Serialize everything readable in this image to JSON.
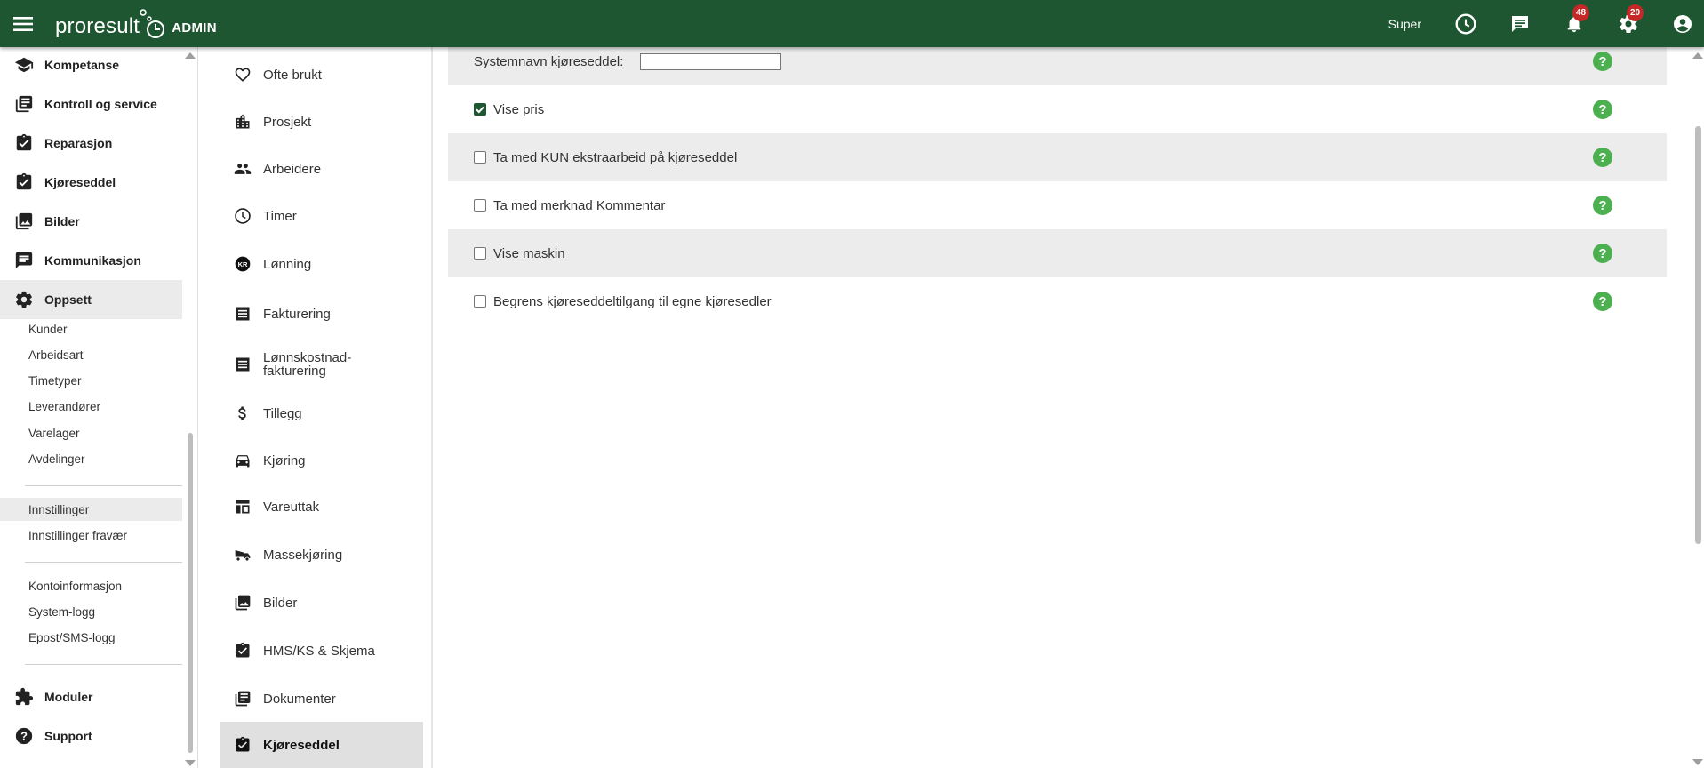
{
  "header": {
    "brand": "proresult",
    "admin_label": "ADMIN",
    "user_label": "Super",
    "notifications_count": "48",
    "settings_count": "20"
  },
  "sidebar": {
    "items": [
      {
        "label": "Kompetanse",
        "icon": "school-icon"
      },
      {
        "label": "Kontroll og service",
        "icon": "library-books-icon"
      },
      {
        "label": "Reparasjon",
        "icon": "assignment-check-icon"
      },
      {
        "label": "Kjøreseddel",
        "icon": "assignment-check-icon"
      },
      {
        "label": "Bilder",
        "icon": "photo-library-icon"
      },
      {
        "label": "Kommunikasjon",
        "icon": "chat-icon"
      },
      {
        "label": "Oppsett",
        "icon": "gear-icon"
      }
    ],
    "subitems": [
      "Kunder",
      "Arbeidsart",
      "Timetyper",
      "Leverandører",
      "Varelager",
      "Avdelinger"
    ],
    "settings_items": [
      "Innstillinger",
      "Innstillinger fravær"
    ],
    "account_items": [
      "Kontoinformasjon",
      "System-logg",
      "Epost/SMS-logg"
    ],
    "bottom_items": [
      {
        "label": "Moduler",
        "icon": "puzzle-icon"
      },
      {
        "label": "Support",
        "icon": "help-circle-icon"
      }
    ]
  },
  "subnav": {
    "items": [
      {
        "label": "Ofte brukt",
        "icon": "heart-icon"
      },
      {
        "label": "Prosjekt",
        "icon": "building-icon"
      },
      {
        "label": "Arbeidere",
        "icon": "people-icon"
      },
      {
        "label": "Timer",
        "icon": "clock-icon"
      },
      {
        "label": "Lønning",
        "icon": "kr-coin-icon"
      },
      {
        "label": "Fakturering",
        "icon": "receipt-icon"
      },
      {
        "label": "Lønnskostnad-fakturering",
        "icon": "receipt-icon"
      },
      {
        "label": "Tillegg",
        "icon": "dollar-icon"
      },
      {
        "label": "Kjøring",
        "icon": "car-icon"
      },
      {
        "label": "Vareuttak",
        "icon": "dashboard-icon"
      },
      {
        "label": "Massekjøring",
        "icon": "truck-icon"
      },
      {
        "label": "Bilder",
        "icon": "photo-library-icon"
      },
      {
        "label": "HMS/KS & Skjema",
        "icon": "assignment-check-icon"
      },
      {
        "label": "Dokumenter",
        "icon": "library-books-icon"
      },
      {
        "label": "Kjøreseddel",
        "icon": "assignment-check-icon"
      }
    ],
    "kr_text": "KR"
  },
  "settings": {
    "system_name_label": "Systemnavn kjøreseddel:",
    "system_name_value": "",
    "options": [
      {
        "label": "Vise pris",
        "checked": true
      },
      {
        "label": "Ta med KUN ekstraarbeid på kjøreseddel",
        "checked": false
      },
      {
        "label": "Ta med merknad Kommentar",
        "checked": false
      },
      {
        "label": "Vise maskin",
        "checked": false
      },
      {
        "label": "Begrens kjøreseddeltilgang til egne kjøresedler",
        "checked": false
      }
    ],
    "help_glyph": "?"
  },
  "colors": {
    "header_bg": "#1e5631",
    "help_green": "#4caf50",
    "badge_red": "#c62828"
  }
}
